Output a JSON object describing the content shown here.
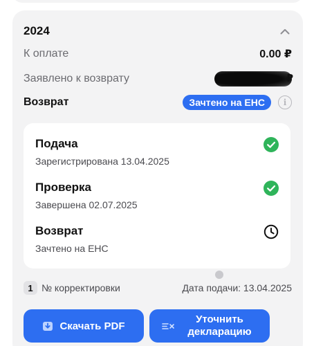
{
  "year_card": {
    "year": "2024",
    "collapse_icon": "chevron-up-icon",
    "to_pay": {
      "label": "К оплате",
      "value": "0.00 ₽"
    },
    "claimed": {
      "label": "Заявлено к возврату",
      "value_hidden": true
    },
    "refund": {
      "label": "Возврат",
      "badge": "Зачтено на ЕНС",
      "info_icon": "info-icon"
    }
  },
  "steps": [
    {
      "title": "Подача",
      "subtitle": "Зарегистрирована 13.04.2025",
      "status_icon": "check-circle-icon"
    },
    {
      "title": "Проверка",
      "subtitle": "Завершена 02.07.2025",
      "status_icon": "check-circle-icon"
    },
    {
      "title": "Возврат",
      "subtitle": "Зачтено на ЕНС",
      "status_icon": "clock-icon"
    }
  ],
  "meta": {
    "correction_number": "1",
    "correction_label": "№ корректировки",
    "submission_date": "Дата подачи: 13.04.2025"
  },
  "actions": {
    "download_pdf": "Скачать PDF",
    "clarify_declaration": "Уточнить декларацию"
  },
  "colors": {
    "accent": "#2d6ef1",
    "success": "#2fb45a",
    "card_bg": "#f3f3f4"
  }
}
